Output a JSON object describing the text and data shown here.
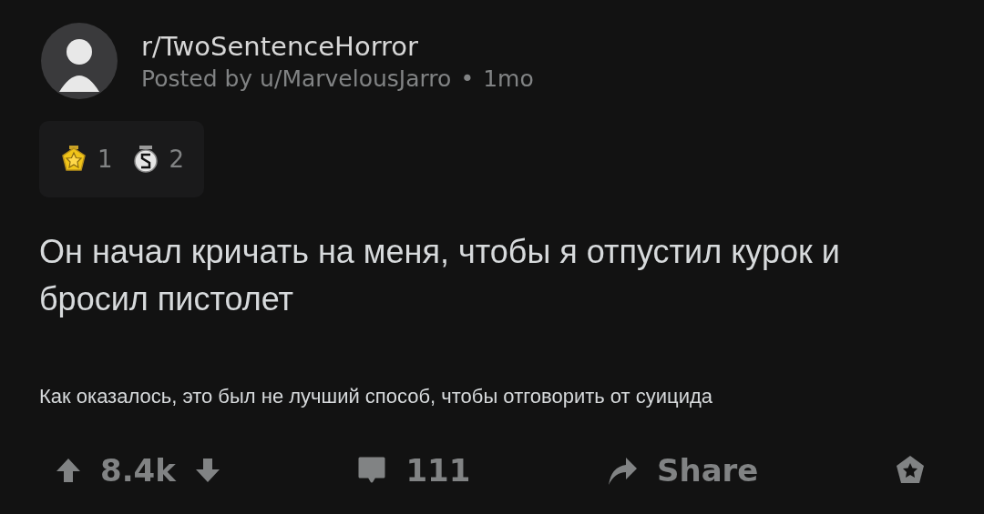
{
  "post": {
    "subreddit": "r/TwoSentenceHorror",
    "posted_by": "Posted by u/MarvelousJarro",
    "separator": "•",
    "age": "1mo"
  },
  "awards": [
    {
      "kind": "star",
      "count": "1"
    },
    {
      "kind": "coin",
      "count": "2"
    }
  ],
  "title": "Он начал кричать на меня, чтобы я отпустил курок и бросил пистолет",
  "body": "Как оказалось, это был не лучший способ, чтобы отговорить от суицида",
  "actions": {
    "score": "8.4k",
    "comments": "111",
    "share": "Share"
  }
}
